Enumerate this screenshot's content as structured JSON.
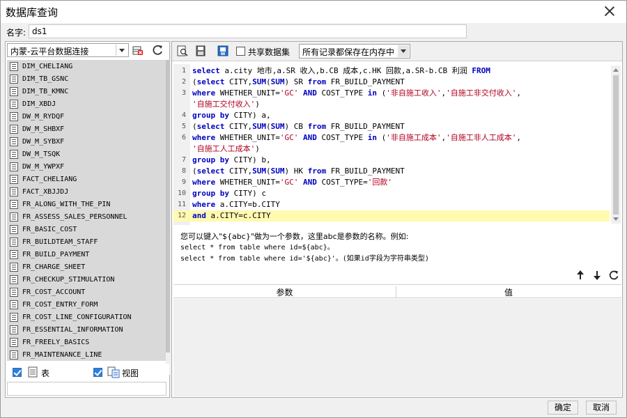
{
  "window": {
    "title": "数据库查询"
  },
  "name_field": {
    "label": "名字:",
    "value": "ds1"
  },
  "connection": {
    "selected": "内蒙-云平台数据连接"
  },
  "tables": [
    "DIM_CHELIANG",
    "DIM_TB_GSNC",
    "DIM_TB_KMNC",
    "DIM_XBDJ",
    "DW_M_RYDQF",
    "DW_M_SHBXF",
    "DW_M_SYBXF",
    "DW_M_TSQK",
    "DW_M_YWPXF",
    "FACT_CHELIANG",
    "FACT_XBJJDJ",
    "FR_ALONG_WITH_THE_PIN",
    "FR_ASSESS_SALES_PERSONNEL",
    "FR_BASIC_COST",
    "FR_BUILDTEAM_STAFF",
    "FR_BUILD_PAYMENT",
    "FR_CHARGE_SHEET",
    "FR_CHECKUP_STIMULATION",
    "FR_COST_ACCOUNT",
    "FR_COST_ENTRY_FORM",
    "FR_COST_LINE_CONFIGURATION",
    "FR_ESSENTIAL_INFORMATION",
    "FR_FREELY_BASICS",
    "FR_MAINTENANCE_LINE"
  ],
  "left_filters": {
    "table_label": "表",
    "view_label": "视图"
  },
  "toolbar": {
    "share_label": "共享数据集",
    "memory_option": "所有记录都保存在内存中"
  },
  "sql_lines": [
    [
      [
        "kw",
        "select"
      ],
      [
        "t",
        " a.city 地市,a.SR 收入,b.CB 成本,c.HK 回款,a.SR-b.CB 利润 "
      ],
      [
        "kw",
        "FROM"
      ]
    ],
    [
      [
        "t",
        "("
      ],
      [
        "kw",
        "select"
      ],
      [
        "t",
        " CITY,"
      ],
      [
        "kw",
        "SUM"
      ],
      [
        "t",
        "("
      ],
      [
        "kw",
        "SUM"
      ],
      [
        "t",
        ") SR "
      ],
      [
        "kw",
        "from"
      ],
      [
        "t",
        " FR_BUILD_PAYMENT"
      ]
    ],
    [
      [
        "kw",
        "where"
      ],
      [
        "t",
        " WHETHER_UNIT="
      ],
      [
        "str",
        "'GC'"
      ],
      [
        "t",
        " "
      ],
      [
        "kw",
        "AND"
      ],
      [
        "t",
        " COST_TYPE "
      ],
      [
        "kw",
        "in"
      ],
      [
        "t",
        " ("
      ],
      [
        "str",
        "'非自施工收入'"
      ],
      [
        "t",
        ","
      ],
      [
        "str",
        "'自施工非交付收入'"
      ],
      [
        "t",
        ","
      ]
    ],
    [
      [
        "str",
        "'自施工交付收入'"
      ],
      [
        "t",
        ")"
      ]
    ],
    [
      [
        "kw",
        "group by"
      ],
      [
        "t",
        " CITY) a,"
      ]
    ],
    [
      [
        "t",
        "("
      ],
      [
        "kw",
        "select"
      ],
      [
        "t",
        " CITY,"
      ],
      [
        "kw",
        "SUM"
      ],
      [
        "t",
        "("
      ],
      [
        "kw",
        "SUM"
      ],
      [
        "t",
        ") CB "
      ],
      [
        "kw",
        "from"
      ],
      [
        "t",
        " FR_BUILD_PAYMENT"
      ]
    ],
    [
      [
        "kw",
        "where"
      ],
      [
        "t",
        " WHETHER_UNIT="
      ],
      [
        "str",
        "'GC'"
      ],
      [
        "t",
        " "
      ],
      [
        "kw",
        "AND"
      ],
      [
        "t",
        " COST_TYPE "
      ],
      [
        "kw",
        "in"
      ],
      [
        "t",
        " ("
      ],
      [
        "str",
        "'非自施工成本'"
      ],
      [
        "t",
        ","
      ],
      [
        "str",
        "'自施工非人工成本'"
      ],
      [
        "t",
        ","
      ]
    ],
    [
      [
        "str",
        "'自施工人工成本'"
      ],
      [
        "t",
        ")"
      ]
    ],
    [
      [
        "kw",
        "group by"
      ],
      [
        "t",
        " CITY) b,"
      ]
    ],
    [
      [
        "t",
        "("
      ],
      [
        "kw",
        "select"
      ],
      [
        "t",
        " CITY,"
      ],
      [
        "kw",
        "SUM"
      ],
      [
        "t",
        "("
      ],
      [
        "kw",
        "SUM"
      ],
      [
        "t",
        ") HK "
      ],
      [
        "kw",
        "from"
      ],
      [
        "t",
        " FR_BUILD_PAYMENT"
      ]
    ],
    [
      [
        "kw",
        "where"
      ],
      [
        "t",
        " WHETHER_UNIT="
      ],
      [
        "str",
        "'GC'"
      ],
      [
        "t",
        " "
      ],
      [
        "kw",
        "AND"
      ],
      [
        "t",
        " COST_TYPE="
      ],
      [
        "str",
        "'回款'"
      ]
    ],
    [
      [
        "kw",
        "group by"
      ],
      [
        "t",
        " CITY) c"
      ]
    ],
    [
      [
        "kw",
        "where"
      ],
      [
        "t",
        " a.CITY=b.CITY"
      ]
    ],
    [
      [
        "kw",
        "and"
      ],
      [
        "t",
        " a.CITY=c.CITY"
      ]
    ]
  ],
  "line_numbers": [
    "1",
    "2",
    "3",
    "",
    "4",
    "5",
    "6",
    "",
    "7",
    "8",
    "9",
    "10",
    "11",
    "12"
  ],
  "hint": {
    "line1": "您可以键入\"${abc}\"做为一个参数，这里abc是参数的名称。例如:",
    "line2": "select * from table where id=${abc}。",
    "line3": "select * from table where id='${abc}'。(如果id字段为字符串类型)"
  },
  "param_table": {
    "col_param": "参数",
    "col_value": "值"
  },
  "buttons": {
    "ok": "确定",
    "cancel": "取消"
  }
}
